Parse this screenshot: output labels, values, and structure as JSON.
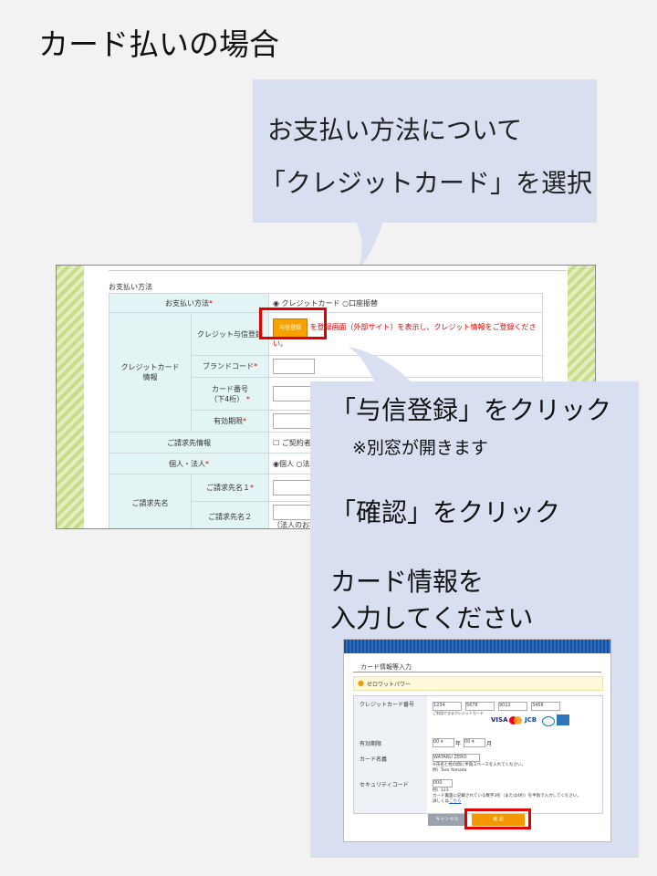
{
  "title": "カード払いの場合",
  "callout1": {
    "line1": "お支払い方法について",
    "line2": "「クレジットカード」を選択"
  },
  "callout2": {
    "step1": "「与信登録」をクリック",
    "step1_note": "※別窓が開きます",
    "step2": "「確認」をクリック",
    "step3_line1": "カード情報を",
    "step3_line2": "入力してください"
  },
  "form": {
    "section_title": "お支払い方法",
    "payment_method_label": "お支払い方法",
    "required_mark": "*",
    "option_credit": "クレジットカード",
    "option_bank": "口座振替",
    "credit_group_label": "クレジットカード\n情報",
    "yoshin_label": "クレジット与信登録",
    "yoshin_button": "与信登録",
    "yoshin_text_part1": "を",
    "yoshin_text_part2": "登録画面（外部サイト）を表示し、クレジット情報をご登録くださ",
    "yoshin_text_part3": "い。",
    "brand_code_label": "ブランドコード",
    "card_number_label": "カード番号\n（下4桁）",
    "expiry_label": "有効期限",
    "billing_info_label": "ご請求先情報",
    "billing_info_value": "ご契約者と",
    "personal_corp_label": "個人・法人",
    "personal_option": "個人",
    "corp_option": "法",
    "billing_name_group_label": "ご請求先名",
    "billing_name1_label": "ご請求先名１",
    "billing_name2_label": "ご請求先名２",
    "billing_name2_note": "（法人のお客"
  },
  "card_window": {
    "heading": "カード情報等入力",
    "provider": "ゼロワットパワー",
    "card_number_label": "クレジットカード番号",
    "card_number_parts": [
      "1234",
      "5678",
      "9012",
      "3456"
    ],
    "card_note": "ご利用できるクレジットカード",
    "brands": [
      "VISA",
      "JCB"
    ],
    "expiry_label": "有効期限",
    "expiry_month": "00",
    "expiry_year": "00",
    "year_unit": "年",
    "month_unit": "月",
    "name_label": "カード名義",
    "name_value": "WATARU ZERO",
    "name_note": "※氏名と姓の間に半角スペースを入れてください。",
    "name_example": "例）Taro Yamada",
    "security_label": "セキュリティコード",
    "security_value": "000",
    "security_example": "例）123",
    "security_note": "カード裏面に記載されている数字3桁（または4桁）を半角で入力してください。",
    "security_link_prefix": "詳しくは",
    "security_link": "こちら",
    "cancel_button": "キャンセル",
    "confirm_button": "確 認"
  },
  "colors": {
    "callout_bg": "#d7dff0",
    "highlight_red": "#e00000",
    "button_orange": "#f6a200",
    "header_cell": "#e3f4f5"
  }
}
